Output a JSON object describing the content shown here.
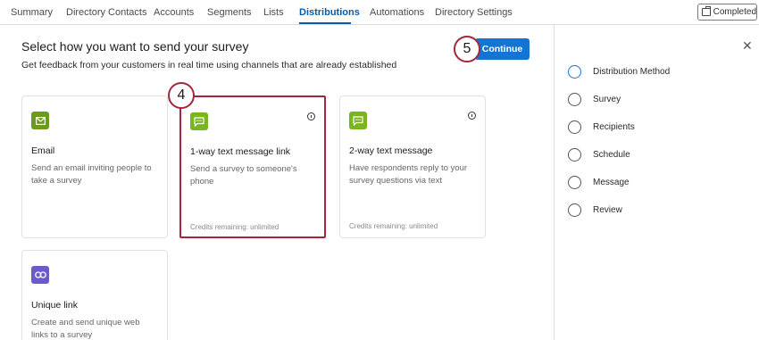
{
  "tabs": [
    "Summary",
    "Directory Contacts",
    "Accounts",
    "Segments",
    "Lists",
    "Distributions",
    "Automations",
    "Directory Settings"
  ],
  "completed_label": "Completed",
  "heading": "Select how you want to send your survey",
  "subheading": "Get feedback from your customers in real time using channels that are already established",
  "continue_label": "Continue",
  "step_markers": {
    "continue_marker": "5",
    "card_marker": "4"
  },
  "cards": [
    {
      "title": "Email",
      "desc": "Send an email inviting people to take a survey",
      "credits": "",
      "icon": "mail-icon",
      "icon_color": "#6a9a1f"
    },
    {
      "title": "1-way text message link",
      "desc": "Send a survey to someone's phone",
      "credits": "Credits remaining: unlimited",
      "icon": "chat-icon",
      "icon_color": "#7ab51d"
    },
    {
      "title": "2-way text message",
      "desc": "Have respondents reply to your survey questions via text",
      "credits": "Credits remaining: unlimited",
      "icon": "chat-icon",
      "icon_color": "#7ab51d"
    },
    {
      "title": "Unique link",
      "desc": "Create and send unique web links to a survey",
      "credits": "",
      "icon": "link-icon",
      "icon_color": "#6a5acd"
    }
  ],
  "steps": [
    "Distribution Method",
    "Survey",
    "Recipients",
    "Schedule",
    "Message",
    "Review"
  ],
  "colors": {
    "accent": "#1474d4",
    "highlight": "#a2273a",
    "active_tab": "#0b5aa8"
  }
}
